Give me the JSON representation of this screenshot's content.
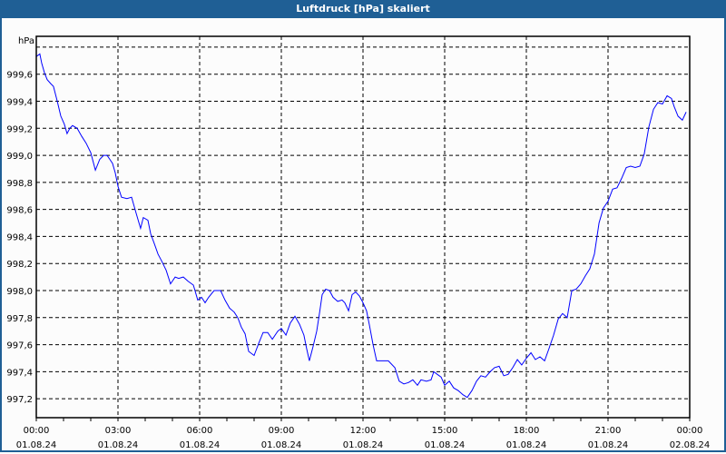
{
  "window": {
    "title": "Luftdruck [hPa] skaliert"
  },
  "colors": {
    "titlebar": "#1f5f95",
    "line": "#0000ff",
    "grid": "#000000"
  },
  "chart_data": {
    "type": "line",
    "title": "Luftdruck [hPa] skaliert",
    "ylabel": "hPa",
    "xlabel": "",
    "ylim": [
      997.06,
      999.88
    ],
    "xlim_hours": [
      0,
      24
    ],
    "y_grid": [
      999.8,
      999.6,
      999.4,
      999.2,
      999.0,
      998.8,
      998.6,
      998.4,
      998.2,
      998.0,
      997.8,
      997.6,
      997.4,
      997.2
    ],
    "y_tick_labels": [
      "999,6",
      "999,4",
      "999,2",
      "999,0",
      "998,8",
      "998,6",
      "998,4",
      "998,2",
      "998,0",
      "997,8",
      "997,6",
      "997,4",
      "997,2"
    ],
    "y_tick_values": [
      999.6,
      999.4,
      999.2,
      999.0,
      998.8,
      998.6,
      998.4,
      998.2,
      998.0,
      997.8,
      997.6,
      997.4,
      997.2
    ],
    "x_ticks": [
      {
        "hour": 0,
        "time": "00:00",
        "date": "01.08.24"
      },
      {
        "hour": 3,
        "time": "03:00",
        "date": "01.08.24"
      },
      {
        "hour": 6,
        "time": "06:00",
        "date": "01.08.24"
      },
      {
        "hour": 9,
        "time": "09:00",
        "date": "01.08.24"
      },
      {
        "hour": 12,
        "time": "12:00",
        "date": "01.08.24"
      },
      {
        "hour": 15,
        "time": "15:00",
        "date": "01.08.24"
      },
      {
        "hour": 18,
        "time": "18:00",
        "date": "01.08.24"
      },
      {
        "hour": 21,
        "time": "21:00",
        "date": "01.08.24"
      },
      {
        "hour": 24,
        "time": "00:00",
        "date": "02.08.24"
      }
    ],
    "grid": true,
    "series": [
      {
        "name": "Luftdruck",
        "points": [
          [
            0,
            999.73
          ],
          [
            0.13,
            999.75
          ],
          [
            0.2,
            999.68
          ],
          [
            0.3,
            999.61
          ],
          [
            0.4,
            999.56
          ],
          [
            0.53,
            999.53
          ],
          [
            0.63,
            999.51
          ],
          [
            0.77,
            999.4
          ],
          [
            0.9,
            999.29
          ],
          [
            1.03,
            999.23
          ],
          [
            1.13,
            999.16
          ],
          [
            1.23,
            999.2
          ],
          [
            1.33,
            999.22
          ],
          [
            1.5,
            999.2
          ],
          [
            1.67,
            999.14
          ],
          [
            1.83,
            999.09
          ],
          [
            2,
            999.02
          ],
          [
            2.17,
            998.89
          ],
          [
            2.33,
            998.97
          ],
          [
            2.47,
            999.0
          ],
          [
            2.6,
            999.0
          ],
          [
            2.7,
            998.97
          ],
          [
            2.8,
            998.94
          ],
          [
            2.9,
            998.87
          ],
          [
            3,
            998.77
          ],
          [
            3.13,
            998.69
          ],
          [
            3.33,
            998.68
          ],
          [
            3.5,
            998.69
          ],
          [
            3.67,
            998.57
          ],
          [
            3.83,
            998.46
          ],
          [
            3.93,
            998.54
          ],
          [
            4.1,
            998.52
          ],
          [
            4.2,
            998.42
          ],
          [
            4.33,
            998.35
          ],
          [
            4.47,
            998.27
          ],
          [
            4.6,
            998.22
          ],
          [
            4.77,
            998.15
          ],
          [
            4.93,
            998.05
          ],
          [
            5.1,
            998.1
          ],
          [
            5.23,
            998.09
          ],
          [
            5.4,
            998.1
          ],
          [
            5.57,
            998.07
          ],
          [
            5.77,
            998.04
          ],
          [
            5.93,
            997.93
          ],
          [
            6.07,
            997.95
          ],
          [
            6.2,
            997.91
          ],
          [
            6.33,
            997.95
          ],
          [
            6.53,
            998.0
          ],
          [
            6.77,
            998.0
          ],
          [
            6.93,
            997.93
          ],
          [
            7.1,
            997.87
          ],
          [
            7.27,
            997.84
          ],
          [
            7.4,
            997.8
          ],
          [
            7.53,
            997.73
          ],
          [
            7.67,
            997.68
          ],
          [
            7.8,
            997.55
          ],
          [
            8,
            997.52
          ],
          [
            8.17,
            997.61
          ],
          [
            8.33,
            997.69
          ],
          [
            8.5,
            997.69
          ],
          [
            8.67,
            997.64
          ],
          [
            8.87,
            997.7
          ],
          [
            9,
            997.72
          ],
          [
            9.17,
            997.67
          ],
          [
            9.33,
            997.76
          ],
          [
            9.5,
            997.81
          ],
          [
            9.67,
            997.75
          ],
          [
            9.83,
            997.67
          ],
          [
            9.93,
            997.57
          ],
          [
            10.03,
            997.48
          ],
          [
            10.17,
            997.59
          ],
          [
            10.3,
            997.7
          ],
          [
            10.4,
            997.83
          ],
          [
            10.5,
            997.97
          ],
          [
            10.63,
            998.01
          ],
          [
            10.77,
            998.0
          ],
          [
            10.9,
            997.95
          ],
          [
            11.07,
            997.92
          ],
          [
            11.23,
            997.93
          ],
          [
            11.33,
            997.91
          ],
          [
            11.47,
            997.85
          ],
          [
            11.6,
            997.97
          ],
          [
            11.73,
            997.99
          ],
          [
            11.87,
            997.96
          ],
          [
            12,
            997.91
          ],
          [
            12.13,
            997.85
          ],
          [
            12.23,
            997.75
          ],
          [
            12.37,
            997.6
          ],
          [
            12.5,
            997.48
          ],
          [
            12.67,
            997.48
          ],
          [
            12.93,
            997.48
          ],
          [
            13.17,
            997.43
          ],
          [
            13.33,
            997.33
          ],
          [
            13.5,
            997.31
          ],
          [
            13.67,
            997.32
          ],
          [
            13.83,
            997.34
          ],
          [
            14,
            997.3
          ],
          [
            14.13,
            997.34
          ],
          [
            14.33,
            997.33
          ],
          [
            14.5,
            997.34
          ],
          [
            14.6,
            997.4
          ],
          [
            14.73,
            997.38
          ],
          [
            14.87,
            997.36
          ],
          [
            15,
            997.3
          ],
          [
            15.17,
            997.33
          ],
          [
            15.33,
            997.28
          ],
          [
            15.5,
            997.26
          ],
          [
            15.67,
            997.23
          ],
          [
            15.83,
            997.21
          ],
          [
            16,
            997.26
          ],
          [
            16.17,
            997.33
          ],
          [
            16.33,
            997.37
          ],
          [
            16.5,
            997.36
          ],
          [
            16.67,
            997.4
          ],
          [
            16.83,
            997.43
          ],
          [
            17,
            997.44
          ],
          [
            17.17,
            997.37
          ],
          [
            17.33,
            997.38
          ],
          [
            17.5,
            997.43
          ],
          [
            17.67,
            997.49
          ],
          [
            17.83,
            997.45
          ],
          [
            18,
            997.5
          ],
          [
            18.17,
            997.54
          ],
          [
            18.33,
            997.49
          ],
          [
            18.5,
            997.51
          ],
          [
            18.67,
            997.48
          ],
          [
            18.83,
            997.57
          ],
          [
            19,
            997.67
          ],
          [
            19.17,
            997.79
          ],
          [
            19.33,
            997.83
          ],
          [
            19.5,
            997.8
          ],
          [
            19.67,
            998.0
          ],
          [
            19.83,
            998.01
          ],
          [
            20,
            998.05
          ],
          [
            20.17,
            998.11
          ],
          [
            20.33,
            998.16
          ],
          [
            20.5,
            998.27
          ],
          [
            20.67,
            998.5
          ],
          [
            20.83,
            998.61
          ],
          [
            21,
            998.66
          ],
          [
            21.17,
            998.75
          ],
          [
            21.33,
            998.76
          ],
          [
            21.5,
            998.83
          ],
          [
            21.67,
            998.91
          ],
          [
            21.83,
            998.92
          ],
          [
            22,
            998.91
          ],
          [
            22.17,
            998.92
          ],
          [
            22.33,
            999.01
          ],
          [
            22.5,
            999.21
          ],
          [
            22.67,
            999.34
          ],
          [
            22.83,
            999.39
          ],
          [
            23,
            999.38
          ],
          [
            23.17,
            999.44
          ],
          [
            23.33,
            999.42
          ],
          [
            23.43,
            999.36
          ],
          [
            23.57,
            999.29
          ],
          [
            23.73,
            999.26
          ],
          [
            23.87,
            999.32
          ]
        ]
      }
    ]
  }
}
